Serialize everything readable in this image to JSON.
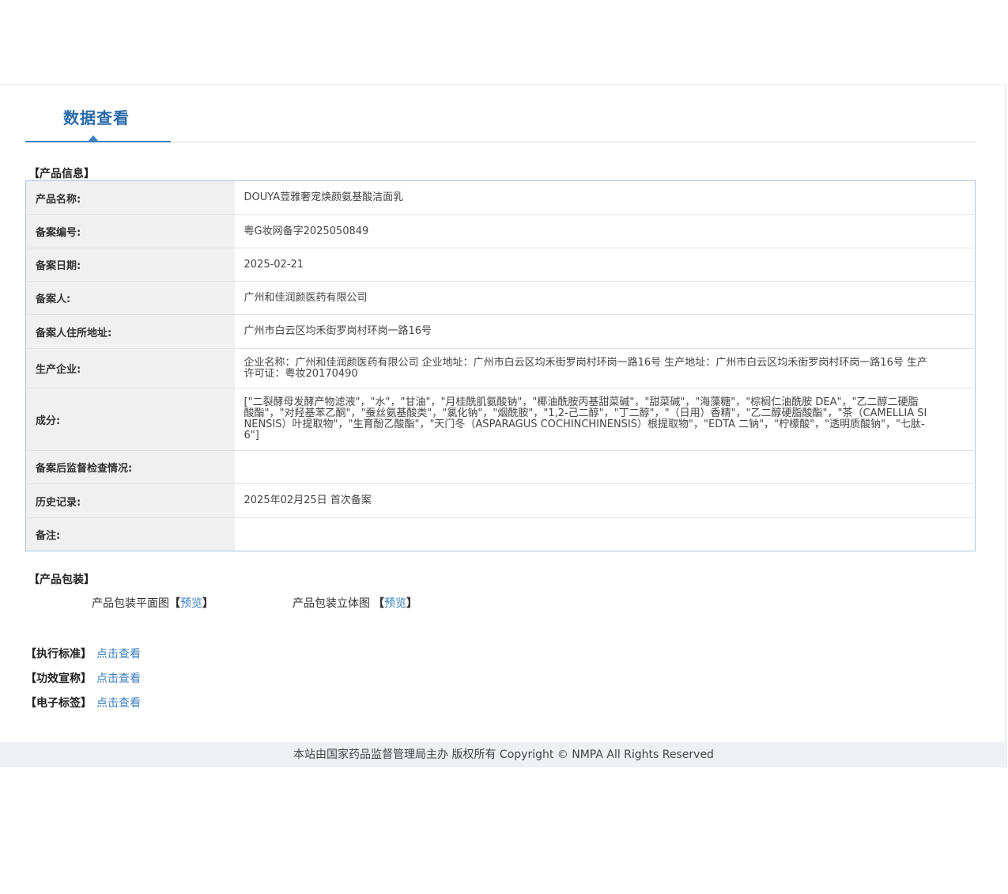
{
  "page": {
    "tab_title": "数据查看"
  },
  "product_info": {
    "section_title": "【产品信息】",
    "rows": [
      {
        "label": "产品名称:",
        "value": "DOUYA荳雅奢宠焕颜氨基酸洁面乳"
      },
      {
        "label": "备案编号:",
        "value": "粤G妆网备字2025050849"
      },
      {
        "label": "备案日期:",
        "value": "2025-02-21"
      },
      {
        "label": "备案人:",
        "value": "广州和佳润颜医药有限公司"
      },
      {
        "label": "备案人住所地址:",
        "value": "广州市白云区均禾街罗岗村环岗一路16号"
      },
      {
        "label": "生产企业:",
        "value": "企业名称：广州和佳润颜医药有限公司 企业地址：广州市白云区均禾街罗岗村环岗一路16号 生产地址：广州市白云区均禾街罗岗村环岗一路16号 生产许可证：粤妆20170490"
      },
      {
        "label": "成分:",
        "value": "[\"二裂酵母发酵产物滤液\"，\"水\"，\"甘油\"，\"月桂酰肌氨酸钠\"，\"椰油酰胺丙基甜菜碱\"，\"甜菜碱\"，\"海藻糖\"，\"棕榈仁油酰胺 DEA\"，\"乙二醇二硬脂酸酯\"，\"对羟基苯乙酮\"，\"蚕丝氨基酸类\"，\"氯化钠\"，\"烟酰胺\"，\"1,2-己二醇\"，\"丁二醇\"，\"（日用）香精\"，\"乙二醇硬脂酸酯\"，\"茶（CAMELLIA SINENSIS）叶提取物\"，\"生育酚乙酸酯\"，\"天门冬（ASPARAGUS COCHINCHINENSIS）根提取物\"，\"EDTA 二钠\"，\"柠檬酸\"，\"透明质酸钠\"，\"七肽-6\"]"
      },
      {
        "label": "备案后监督检查情况:",
        "value": ""
      },
      {
        "label": "历史记录:",
        "value": "2025年02月25日 首次备案"
      },
      {
        "label": "备注:",
        "value": ""
      }
    ]
  },
  "packaging": {
    "section_title": "【产品包装】",
    "flat_label": "产品包装平面图",
    "stereo_label": "产品包装立体图",
    "bracket_open": "【",
    "bracket_close": "】",
    "preview_link": "预览"
  },
  "extras": [
    {
      "label": "【执行标准】",
      "link": "点击查看"
    },
    {
      "label": "【功效宣称】",
      "link": "点击查看"
    },
    {
      "label": "【电子标签】",
      "link": "点击查看"
    }
  ],
  "footer": {
    "text": "本站由国家药品监督管理局主办 版权所有 Copyright © NMPA All Rights Reserved"
  },
  "colors": {
    "accent": "#3a7fc0",
    "title": "#2a6ba8",
    "label_bg": "#f0f0f0",
    "table_border": "#a9c4e2",
    "footer_bg": "#eef0f3"
  }
}
